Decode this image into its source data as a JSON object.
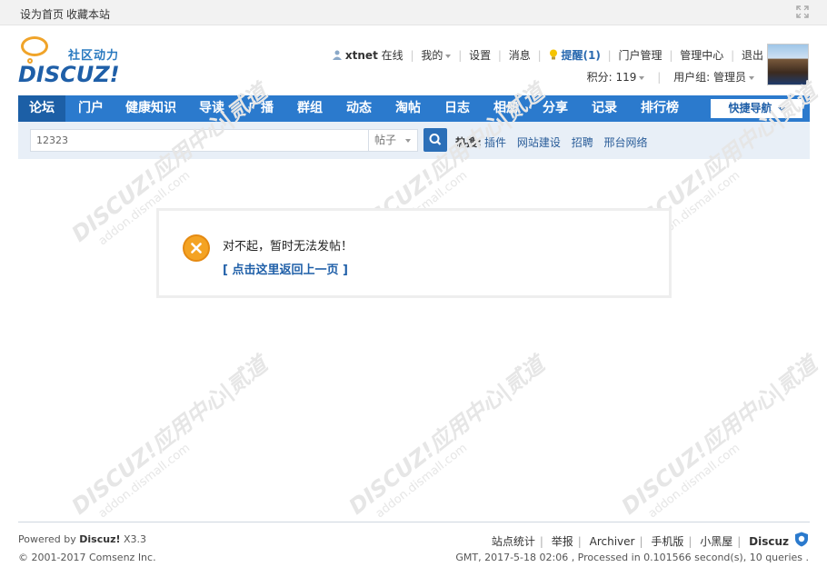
{
  "topbar": {
    "set_home": "设为首页",
    "bookmark": "收藏本站"
  },
  "logo": {
    "slogan": "社区动力",
    "wordmark": "DISCUZ!"
  },
  "user": {
    "name": "xtnet",
    "status": "在线",
    "menu": [
      "我的",
      "设置",
      "消息"
    ],
    "remind": "提醒(1)",
    "links": [
      "门户管理",
      "管理中心",
      "退出"
    ],
    "points": "积分: 119",
    "group": "用户组: 管理员"
  },
  "nav": {
    "items": [
      "论坛",
      "门户",
      "健康知识",
      "导读",
      "广播",
      "群组",
      "动态",
      "淘帖",
      "日志",
      "相册",
      "分享",
      "记录",
      "排行榜"
    ],
    "quick": "快捷导航"
  },
  "search": {
    "value": "12323",
    "type": "帖子",
    "hot_label": "热搜:",
    "hot_links": [
      "插件",
      "网站建设",
      "招聘",
      "邢台网络"
    ]
  },
  "message": {
    "text": "对不起，暂时无法发帖！",
    "back_link": "[ 点击这里返回上一页 ]"
  },
  "watermark": {
    "main": "DISCUZ!应用中心|贰道",
    "sub": "addon.dismall.com"
  },
  "footer": {
    "powered_prefix": "Powered by ",
    "powered_name": "Discuz!",
    "powered_version": " X3.3",
    "copyright": "© 2001-2017 Comsenz Inc.",
    "links": [
      "站点统计",
      "举报",
      "Archiver",
      "手机版",
      "小黑屋"
    ],
    "brand": "Discuz",
    "stats": "GMT, 2017-5-18 02:06 , Processed in 0.101566 second(s), 10 queries ."
  },
  "colors": {
    "nav_bg": "#2b7acd",
    "nav_active": "#1c5fa6",
    "search_bg": "#e8eff7",
    "error_icon": "#f4a323",
    "link": "#1f5fa8"
  }
}
